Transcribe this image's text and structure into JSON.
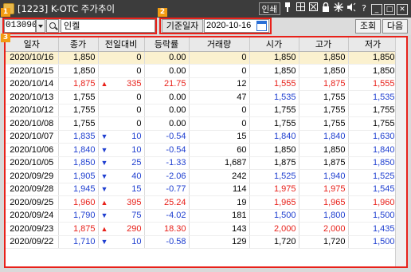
{
  "window": {
    "title": "[1223] K-OTC 주가추이",
    "toolbar_link": "인쇄",
    "icons": [
      "pin-icon",
      "grid-icon",
      "close-box-icon",
      "lock-icon",
      "settings-icon",
      "sound-icon",
      "help-icon",
      "minimize-icon",
      "maximize-icon",
      "close-icon"
    ],
    "help_glyph": "?",
    "minimize_glyph": "_",
    "maximize_glyph": "□",
    "close_glyph": "✕"
  },
  "badges": [
    "1",
    "2",
    "3"
  ],
  "search": {
    "code": "013090",
    "name": "인켈"
  },
  "date_filter": {
    "label": "기준일자",
    "value": "2020-10-16"
  },
  "buttons": {
    "query": "조회",
    "next": "다음"
  },
  "colors": {
    "up": "#e8211a",
    "down": "#1f3fd0",
    "highlight": "#e8211a",
    "badge": "#f39c12",
    "selected_row": "#fbf1cf"
  },
  "table": {
    "columns": [
      "일자",
      "종가",
      "전일대비",
      "등락률",
      "거래량",
      "시가",
      "고가",
      "저가"
    ],
    "rows": [
      {
        "date": "2020/10/16",
        "close": "1,850",
        "dir": "flat",
        "change": "0",
        "rate": "0.00",
        "volume": "0",
        "open": "1,850",
        "high": "1,850",
        "low": "1,850",
        "open_c": "flat",
        "high_c": "flat",
        "low_c": "flat",
        "close_c": "flat"
      },
      {
        "date": "2020/10/15",
        "close": "1,850",
        "dir": "flat",
        "change": "0",
        "rate": "0.00",
        "volume": "0",
        "open": "1,850",
        "high": "1,850",
        "low": "1,850",
        "open_c": "flat",
        "high_c": "flat",
        "low_c": "flat",
        "close_c": "flat"
      },
      {
        "date": "2020/10/14",
        "close": "1,875",
        "dir": "up",
        "change": "335",
        "rate": "21.75",
        "volume": "12",
        "open": "1,555",
        "high": "1,875",
        "low": "1,555",
        "open_c": "up",
        "high_c": "up",
        "low_c": "up",
        "close_c": "up"
      },
      {
        "date": "2020/10/13",
        "close": "1,755",
        "dir": "flat",
        "change": "0",
        "rate": "0.00",
        "volume": "47",
        "open": "1,535",
        "high": "1,755",
        "low": "1,535",
        "open_c": "down",
        "high_c": "flat",
        "low_c": "down",
        "close_c": "flat"
      },
      {
        "date": "2020/10/12",
        "close": "1,755",
        "dir": "flat",
        "change": "0",
        "rate": "0.00",
        "volume": "0",
        "open": "1,755",
        "high": "1,755",
        "low": "1,755",
        "open_c": "flat",
        "high_c": "flat",
        "low_c": "flat",
        "close_c": "flat"
      },
      {
        "date": "2020/10/08",
        "close": "1,755",
        "dir": "flat",
        "change": "0",
        "rate": "0.00",
        "volume": "0",
        "open": "1,755",
        "high": "1,755",
        "low": "1,755",
        "open_c": "flat",
        "high_c": "flat",
        "low_c": "flat",
        "close_c": "flat"
      },
      {
        "date": "2020/10/07",
        "close": "1,835",
        "dir": "down",
        "change": "10",
        "rate": "-0.54",
        "volume": "15",
        "open": "1,840",
        "high": "1,840",
        "low": "1,630",
        "open_c": "down",
        "high_c": "down",
        "low_c": "down",
        "close_c": "down"
      },
      {
        "date": "2020/10/06",
        "close": "1,840",
        "dir": "down",
        "change": "10",
        "rate": "-0.54",
        "volume": "60",
        "open": "1,850",
        "high": "1,850",
        "low": "1,840",
        "open_c": "flat",
        "high_c": "flat",
        "low_c": "down",
        "close_c": "down"
      },
      {
        "date": "2020/10/05",
        "close": "1,850",
        "dir": "down",
        "change": "25",
        "rate": "-1.33",
        "volume": "1,687",
        "open": "1,875",
        "high": "1,875",
        "low": "1,850",
        "open_c": "flat",
        "high_c": "flat",
        "low_c": "down",
        "close_c": "down"
      },
      {
        "date": "2020/09/29",
        "close": "1,905",
        "dir": "down",
        "change": "40",
        "rate": "-2.06",
        "volume": "242",
        "open": "1,525",
        "high": "1,940",
        "low": "1,525",
        "open_c": "down",
        "high_c": "down",
        "low_c": "down",
        "close_c": "down"
      },
      {
        "date": "2020/09/28",
        "close": "1,945",
        "dir": "down",
        "change": "15",
        "rate": "-0.77",
        "volume": "114",
        "open": "1,975",
        "high": "1,975",
        "low": "1,545",
        "open_c": "up",
        "high_c": "up",
        "low_c": "down",
        "close_c": "down"
      },
      {
        "date": "2020/09/25",
        "close": "1,960",
        "dir": "up",
        "change": "395",
        "rate": "25.24",
        "volume": "19",
        "open": "1,965",
        "high": "1,965",
        "low": "1,960",
        "open_c": "up",
        "high_c": "up",
        "low_c": "up",
        "close_c": "up"
      },
      {
        "date": "2020/09/24",
        "close": "1,790",
        "dir": "down",
        "change": "75",
        "rate": "-4.02",
        "volume": "181",
        "open": "1,500",
        "high": "1,800",
        "low": "1,500",
        "open_c": "down",
        "high_c": "down",
        "low_c": "down",
        "close_c": "down"
      },
      {
        "date": "2020/09/23",
        "close": "1,875",
        "dir": "up",
        "change": "290",
        "rate": "18.30",
        "volume": "143",
        "open": "2,000",
        "high": "2,000",
        "low": "1,435",
        "open_c": "up",
        "high_c": "up",
        "low_c": "down",
        "close_c": "up"
      },
      {
        "date": "2020/09/22",
        "close": "1,710",
        "dir": "down",
        "change": "10",
        "rate": "-0.58",
        "volume": "129",
        "open": "1,720",
        "high": "1,720",
        "low": "1,500",
        "open_c": "flat",
        "high_c": "flat",
        "low_c": "down",
        "close_c": "down"
      }
    ]
  }
}
